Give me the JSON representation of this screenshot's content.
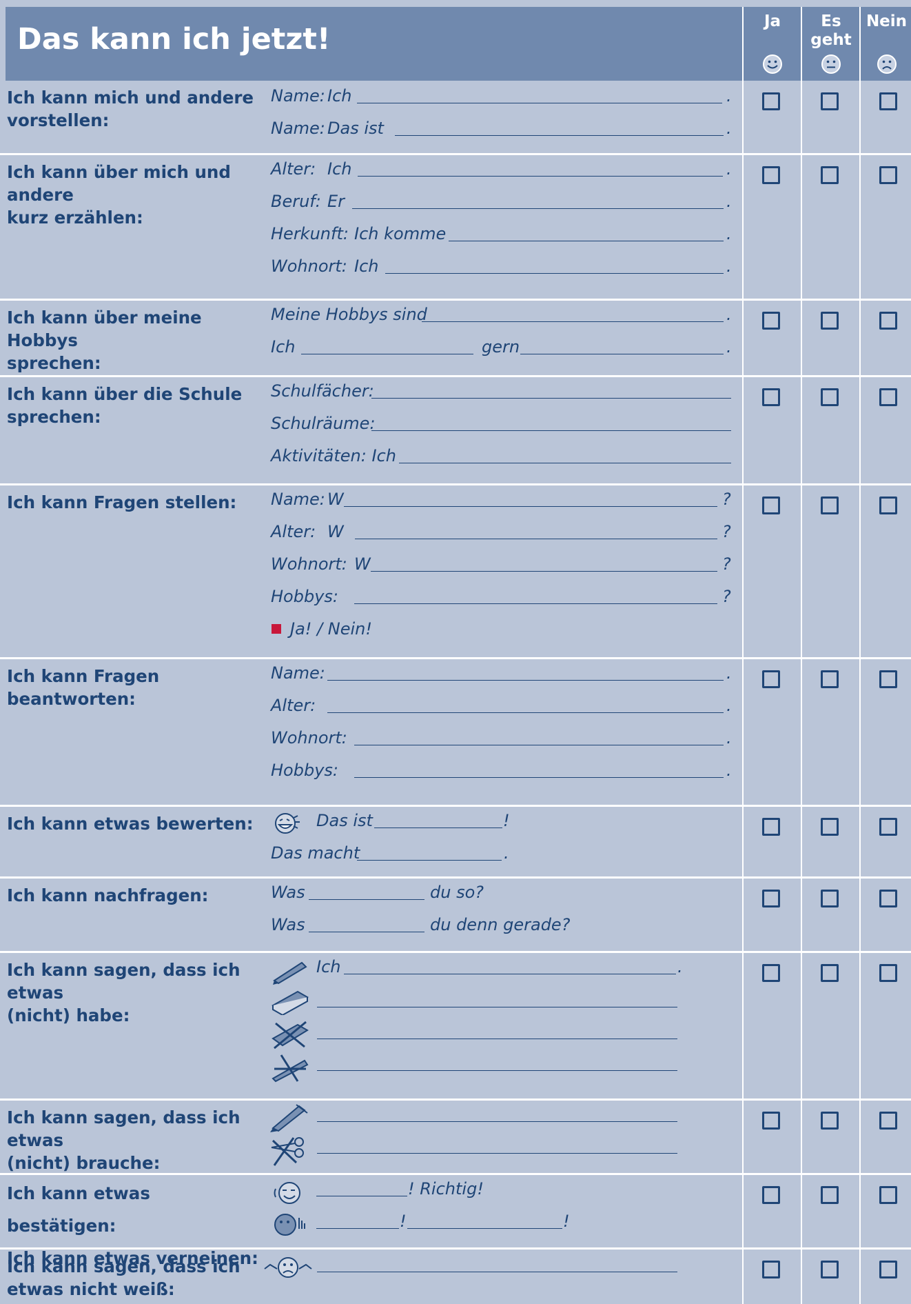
{
  "header": {
    "title": "Das kann ich jetzt!",
    "col_ja": "Ja",
    "col_es_geht_1": "Es",
    "col_es_geht_2": "geht",
    "col_nein": "Nein"
  },
  "rows": [
    {
      "label1": "Ich kann mich und andere",
      "label2": "vorstellen:",
      "lines": [
        {
          "a": "Name:",
          "b": "Ich",
          "end": "."
        },
        {
          "a": "Name:",
          "b": "Das ist",
          "end": "."
        }
      ]
    },
    {
      "label1": "Ich kann über mich und andere",
      "label2": "kurz erzählen:",
      "lines": [
        {
          "a": "Alter:",
          "b": "Ich",
          "end": "."
        },
        {
          "a": "Beruf:",
          "b": "Er",
          "end": "."
        },
        {
          "a": "Herkunft:",
          "b": "Ich komme",
          "end": "."
        },
        {
          "a": "Wohnort:",
          "b": "Ich",
          "end": "."
        }
      ]
    },
    {
      "label1": "Ich kann über meine Hobbys",
      "label2": "sprechen:",
      "lines": [
        {
          "a": "Meine Hobbys sind",
          "end": "."
        },
        {
          "a": "Ich",
          "b": "gern",
          "end": "."
        }
      ]
    },
    {
      "label1": "Ich kann über die Schule",
      "label2": "sprechen:",
      "lines": [
        {
          "a": "Schulfächer:"
        },
        {
          "a": "Schulräume:"
        },
        {
          "a": "Aktivitäten: Ich"
        }
      ]
    },
    {
      "label1": "Ich kann Fragen stellen:",
      "lines": [
        {
          "a": "Name:",
          "b": "W",
          "end": "?"
        },
        {
          "a": "Alter:",
          "b": "W",
          "end": "?"
        },
        {
          "a": "Wohnort:",
          "b": "W",
          "end": "?"
        },
        {
          "a": "Hobbys:",
          "end": "?"
        },
        {
          "a": "Ja! / Nein!"
        }
      ]
    },
    {
      "label1": "Ich kann Fragen",
      "label2": "beantworten:",
      "lines": [
        {
          "a": "Name:",
          "end": "."
        },
        {
          "a": "Alter:",
          "end": "."
        },
        {
          "a": "Wohnort:",
          "end": "."
        },
        {
          "a": "Hobbys:",
          "end": "."
        }
      ]
    },
    {
      "label1": "Ich kann etwas bewerten:",
      "lines": [
        {
          "a": "Das ist",
          "end": "!"
        },
        {
          "a": "Das macht",
          "end": "."
        }
      ]
    },
    {
      "label1": "Ich kann nachfragen:",
      "lines": [
        {
          "a": "Was",
          "b": "du so?"
        },
        {
          "a": "Was",
          "b": "du denn gerade?"
        }
      ]
    },
    {
      "label1": "Ich kann sagen, dass ich etwas",
      "label2": "(nicht) habe:",
      "lines": [
        {
          "a": "Ich",
          "end": "."
        }
      ]
    },
    {
      "label1": "Ich kann sagen, dass ich etwas",
      "label2": "(nicht) brauche:"
    },
    {
      "label1": "Ich kann etwas bestätigen:",
      "label2": "Ich kann etwas verneinen:",
      "lines": [
        {
          "end": "! Richtig!"
        },
        {
          "mid": "!",
          "end": "!"
        }
      ]
    },
    {
      "label1": "Ich kann sagen, dass ich",
      "label2": "etwas nicht weiß:"
    }
  ]
}
